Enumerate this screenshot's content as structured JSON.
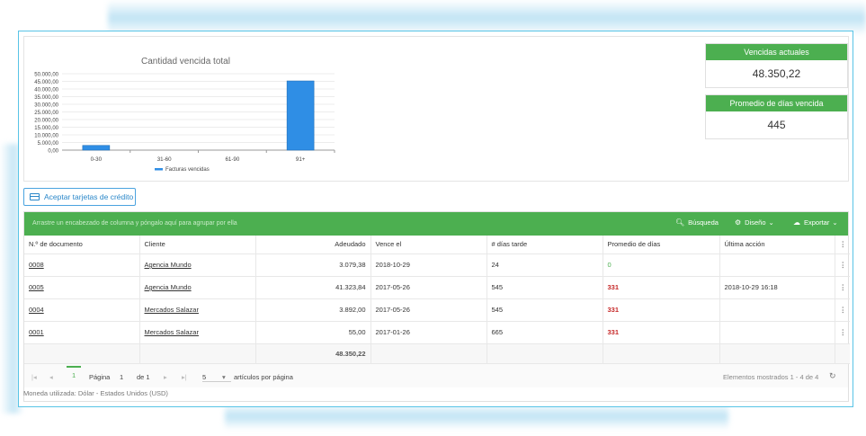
{
  "chart_data": {
    "type": "bar",
    "title": "Cantidad vencida total",
    "categories": [
      "0-30",
      "31-60",
      "61-90",
      "91+"
    ],
    "series": [
      {
        "name": "Facturas vencidas",
        "values": [
          3079.38,
          0,
          0,
          45270.84
        ]
      }
    ],
    "ylim": [
      0,
      50000
    ],
    "yticks": [
      "0,00",
      "5.000,00",
      "10.000,00",
      "15.000,00",
      "20.000,00",
      "25.000,00",
      "30.000,00",
      "35.000,00",
      "40.000,00",
      "45.000,00",
      "50.000,00"
    ],
    "color": "#2f8ee5",
    "legend": "bottom"
  },
  "kpis": {
    "current_label": "Vencidas actuales",
    "current_value": "48.350,22",
    "avg_label": "Promedio de días vencida",
    "avg_value": "445"
  },
  "accept_button": "Aceptar tarjetas de crédito",
  "toolbar": {
    "group_hint": "Arrastre un encabezado de columna y póngalo aquí para agrupar por ella",
    "search": "Búsqueda",
    "design": "Diseño",
    "export": "Exportar"
  },
  "columns": [
    "N.º de documento",
    "Cliente",
    "Adeudado",
    "Vence el",
    "# días tarde",
    "Promedio de días",
    "Última acción"
  ],
  "rows": [
    {
      "doc": "0008",
      "client": "Agencia Mundo",
      "owed": "3.079,38",
      "due": "2018-10-29",
      "late": "24",
      "avg": "0",
      "last": ""
    },
    {
      "doc": "0005",
      "client": "Agencia Mundo",
      "owed": "41.323,84",
      "due": "2017-05-26",
      "late": "545",
      "avg": "331",
      "last": "2018-10-29 16:18"
    },
    {
      "doc": "0004",
      "client": "Mercados Salazar",
      "owed": "3.892,00",
      "due": "2017-05-26",
      "late": "545",
      "avg": "331",
      "last": ""
    },
    {
      "doc": "0001",
      "client": "Mercados Salazar",
      "owed": "55,00",
      "due": "2017-01-26",
      "late": "665",
      "avg": "331",
      "last": ""
    }
  ],
  "total_owed": "48.350,22",
  "pager": {
    "current_page": "1",
    "page_label": "Página",
    "page_input": "1",
    "of_label": "de 1",
    "page_size": "5",
    "per_page_label": "artículos por página",
    "summary": "Elementos mostrados 1 - 4 de 4"
  },
  "currency_note": "Moneda utilizada: Dólar - Estados Unidos (USD)"
}
